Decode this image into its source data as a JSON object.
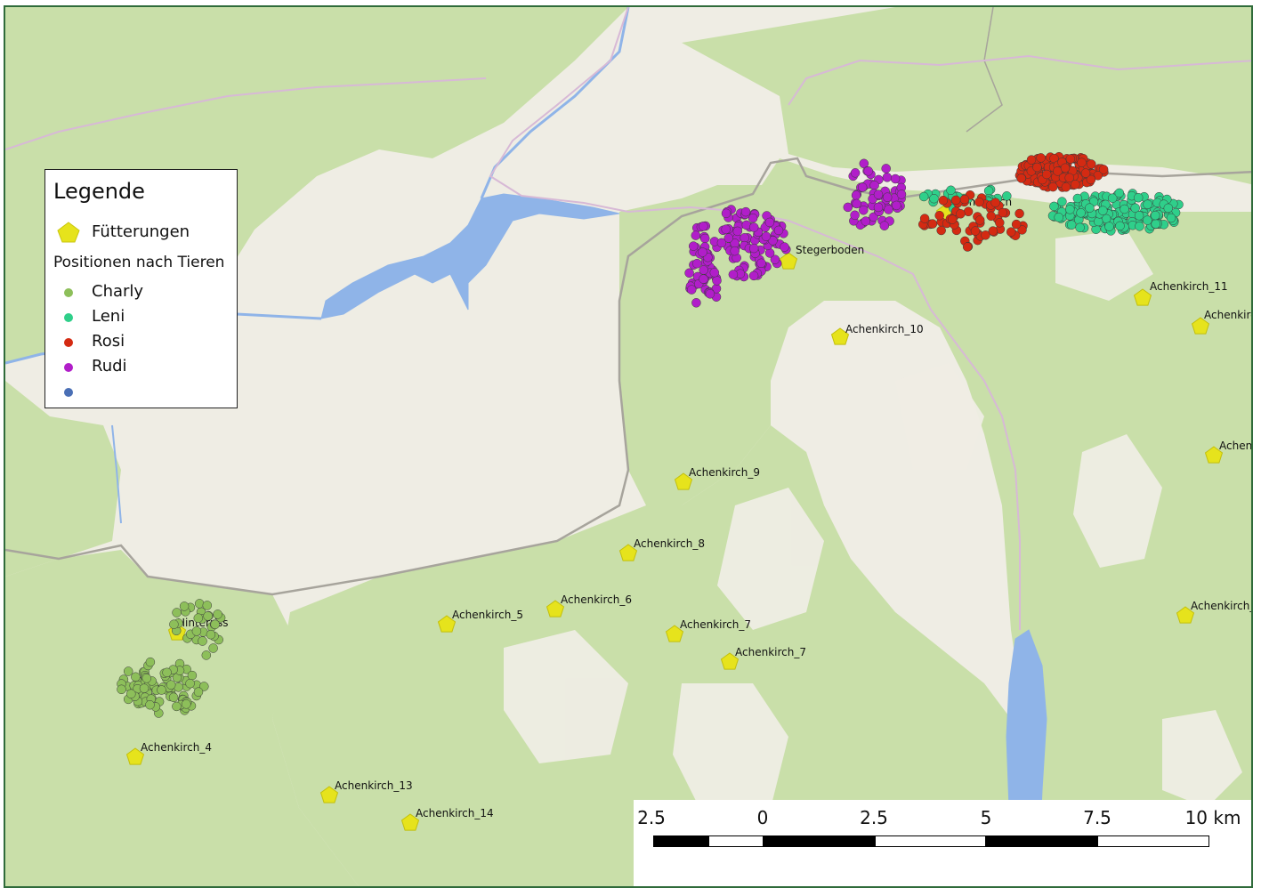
{
  "legend": {
    "title": "Legende",
    "feeding_label": "Fütterungen",
    "positions_heading": "Positionen nach Tieren",
    "animals": [
      {
        "name": "Charly",
        "color": "#8dbf5a"
      },
      {
        "name": "Leni",
        "color": "#2fcf8a"
      },
      {
        "name": "Rosi",
        "color": "#d42a12"
      },
      {
        "name": "Rudi",
        "color": "#b11ec9"
      },
      {
        "name": "",
        "color": "#4a6fb5"
      }
    ],
    "feeding_color": "#e6e31c"
  },
  "feeding_stations": [
    "Stegerboden",
    "Klammbach",
    "Achenkirch_11",
    "Achenkirc",
    "Achenkirch_10",
    "Achenk",
    "Achenkirch_9",
    "Achenkirch_8",
    "Achenkirch_6",
    "Achenkirch_5",
    "Achenkirch_7",
    "Achenkirch_7",
    "Achenkirch_",
    "Hinterriss",
    "Achenkirch_4",
    "Achenkirch_13",
    "Achenkirch_14"
  ],
  "scale": {
    "ticks": [
      "2.5",
      "0",
      "2.5",
      "5",
      "7.5",
      "10 km"
    ]
  },
  "map_colors": {
    "forest": "#c9dfa9",
    "open_land": "#efede4",
    "water": "#8fb4e8",
    "border": "#a7a49c"
  }
}
